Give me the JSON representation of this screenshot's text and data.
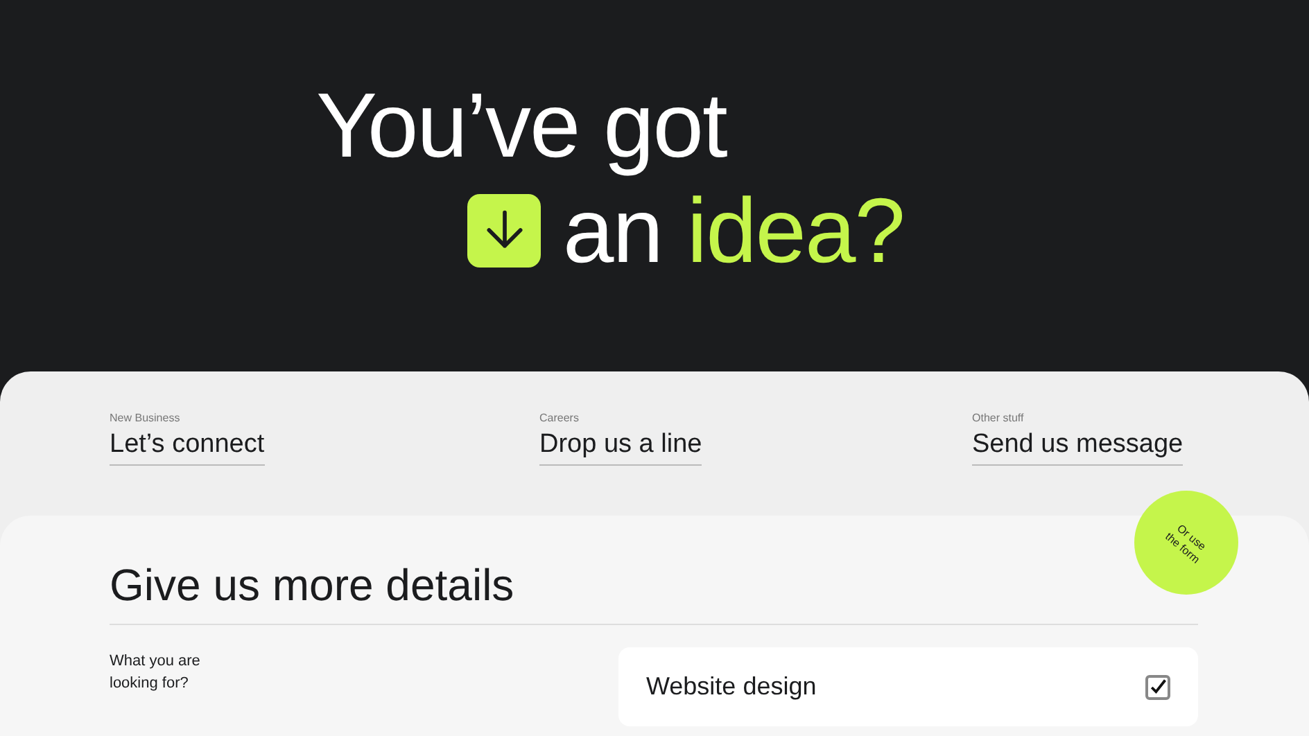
{
  "hero": {
    "line_1": "You’ve got",
    "line_2_plain": "an",
    "line_2_accent": "idea?"
  },
  "contacts": [
    {
      "label": "New Business",
      "link": "Let’s connect"
    },
    {
      "label": "Careers",
      "link": "Drop us a line"
    },
    {
      "label": "Other stuff",
      "link": "Send us message"
    }
  ],
  "badge": {
    "line_1": "Or use",
    "line_2": "the form"
  },
  "form": {
    "title": "Give us more details",
    "field_label": "What you are looking for?",
    "option": {
      "label": "Website design",
      "checked": true
    }
  }
}
